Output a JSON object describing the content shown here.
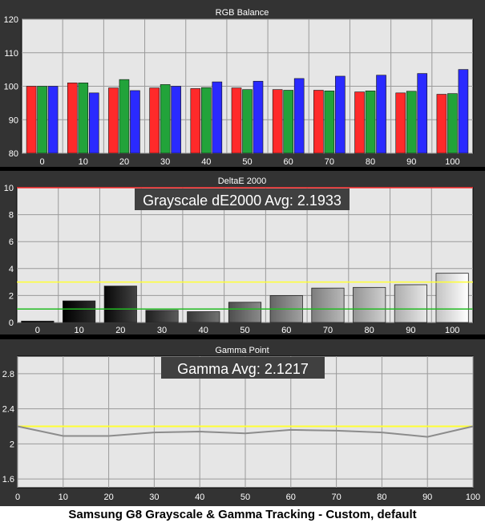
{
  "caption": "Samsung G8 Grayscale & Gamma Tracking - Custom, default",
  "colors": {
    "background": "#000000",
    "panel": "#333333",
    "plot_bg": "#e6e6e6",
    "text": "#ffffff",
    "red": "#ff2a2a",
    "green": "#22a33a",
    "blue": "#2a2aff",
    "yellow": "#ffff33",
    "green_line": "#22bb22",
    "red_line": "#ff3030",
    "gamma_line": "#8c8c8c"
  },
  "chart_data": [
    {
      "type": "bar",
      "title": "RGB Balance",
      "categories": [
        "0",
        "10",
        "20",
        "30",
        "40",
        "50",
        "60",
        "70",
        "80",
        "90",
        "100"
      ],
      "series": [
        {
          "color": "red",
          "values": [
            100,
            101,
            99.5,
            99.5,
            99.3,
            99.5,
            99,
            98.8,
            98.3,
            98,
            97.6
          ]
        },
        {
          "color": "green",
          "values": [
            100,
            101,
            102,
            100.5,
            99.6,
            99,
            98.8,
            98.6,
            98.6,
            98.5,
            97.8
          ]
        },
        {
          "color": "blue",
          "values": [
            100,
            98,
            98.7,
            100,
            101.3,
            101.5,
            102.3,
            103,
            103.3,
            103.8,
            105
          ]
        }
      ],
      "ylim": [
        80,
        120
      ],
      "yticks": [
        "80",
        "90",
        "100",
        "110",
        "120"
      ],
      "grid": true
    },
    {
      "type": "bar",
      "title": "DeltaE 2000",
      "annotation": "Grayscale dE2000 Avg: 2.1933",
      "categories": [
        "0",
        "10",
        "20",
        "30",
        "40",
        "50",
        "60",
        "70",
        "80",
        "90",
        "100"
      ],
      "values": [
        0.1,
        1.6,
        2.7,
        0.9,
        0.8,
        1.5,
        2.0,
        2.55,
        2.6,
        2.8,
        3.65
      ],
      "ylim": [
        0,
        10
      ],
      "yticks": [
        "0",
        "2",
        "4",
        "6",
        "8",
        "10"
      ],
      "reference_lines": [
        {
          "value": 10,
          "color": "red_line"
        },
        {
          "value": 3,
          "color": "yellow"
        },
        {
          "value": 1,
          "color": "green_line"
        }
      ],
      "grid": true
    },
    {
      "type": "line",
      "title": "Gamma Point",
      "annotation": "Gamma Avg: 2.1217",
      "x": [
        0,
        10,
        20,
        30,
        40,
        50,
        60,
        70,
        80,
        90,
        100
      ],
      "y": [
        2.2,
        2.09,
        2.09,
        2.13,
        2.14,
        2.12,
        2.16,
        2.15,
        2.13,
        2.08,
        2.2
      ],
      "target": 2.2,
      "ylim": [
        1.5,
        3.0
      ],
      "yticks": [
        "1.6",
        "2",
        "2.4",
        "2.8"
      ],
      "xticks": [
        "0",
        "10",
        "20",
        "30",
        "40",
        "50",
        "60",
        "70",
        "80",
        "90",
        "100"
      ],
      "xlim": [
        0,
        100
      ],
      "grid": true
    }
  ]
}
